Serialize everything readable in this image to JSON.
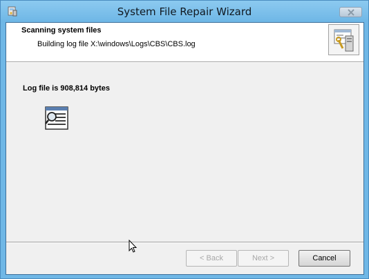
{
  "window": {
    "title": "System File Repair Wizard",
    "app_icon": "wizard-app-icon",
    "close_icon": "close-icon"
  },
  "header": {
    "title": "Scanning system files",
    "subtitle": "Building log file X:\\windows\\Logs\\CBS\\CBS.log",
    "graphic_icon": "computer-tools-icon"
  },
  "body": {
    "log_size_text": "Log file is 908,814 bytes",
    "log_icon": "log-search-icon"
  },
  "footer": {
    "back_label": "< Back",
    "next_label": "Next >",
    "cancel_label": "Cancel",
    "back_enabled": false,
    "next_enabled": false,
    "cancel_enabled": true
  },
  "colors": {
    "frame": "#6fb7e6",
    "client_bg": "#f0f0f0",
    "header_bg": "#ffffff",
    "disabled_text": "#a8a8a8"
  }
}
